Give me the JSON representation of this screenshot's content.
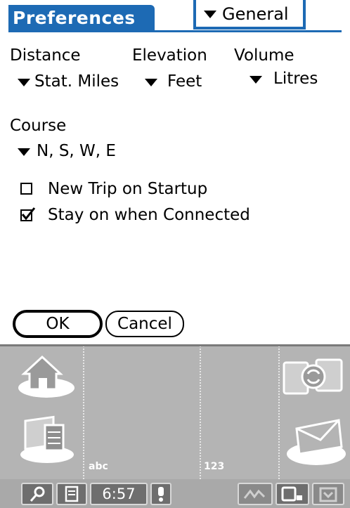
{
  "title": "Preferences",
  "category": {
    "selected": "General"
  },
  "units": {
    "distance": {
      "label": "Distance",
      "value": "Stat. Miles"
    },
    "elevation": {
      "label": "Elevation",
      "value": "Feet"
    },
    "volume": {
      "label": "Volume",
      "value": "Litres"
    }
  },
  "course": {
    "label": "Course",
    "value": "N, S, W, E"
  },
  "options": [
    {
      "label": "New Trip on Startup",
      "checked": false
    },
    {
      "label": "Stay on when Connected",
      "checked": true
    }
  ],
  "buttons": {
    "ok": "OK",
    "cancel": "Cancel"
  },
  "silkscreen": {
    "abc": "abc",
    "num": "123"
  },
  "status": {
    "time": "6:57"
  },
  "icons": [
    "home-icon",
    "applications-icon",
    "sync-icon",
    "mail-icon",
    "find-icon",
    "menu-icon",
    "alert-icon",
    "signal-icon",
    "device-icon",
    "install-icon"
  ]
}
